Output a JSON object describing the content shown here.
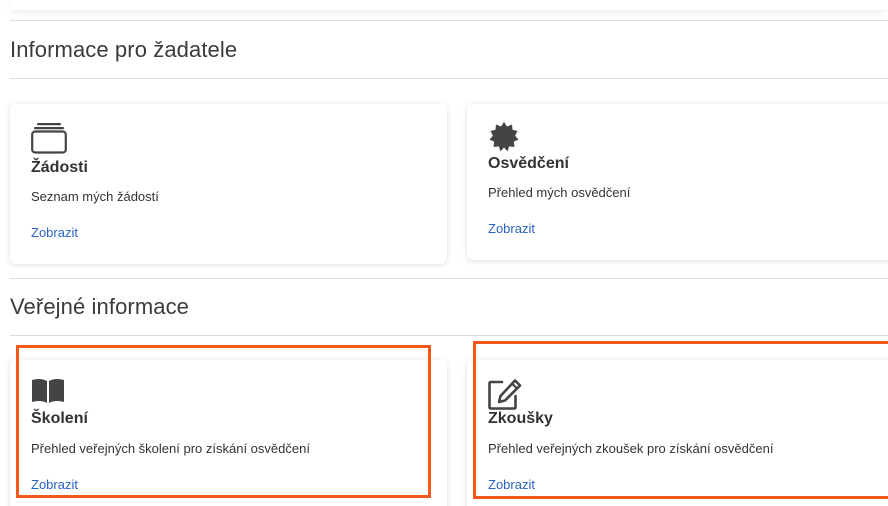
{
  "sections": {
    "applicant": {
      "title": "Informace pro žadatele",
      "cards": [
        {
          "title": "Žádosti",
          "description": "Seznam mých žádostí",
          "link": "Zobrazit",
          "icon": "tray-stack-icon"
        },
        {
          "title": "Osvědčení",
          "description": "Přehled mých osvědčení",
          "link": "Zobrazit",
          "icon": "certificate-badge-icon"
        }
      ]
    },
    "public": {
      "title": "Veřejné informace",
      "cards": [
        {
          "title": "Školení",
          "description": "Přehled veřejných školení pro získání osvědčení",
          "link": "Zobrazit",
          "icon": "open-book-icon"
        },
        {
          "title": "Zkoušky",
          "description": "Přehled veřejných zkoušek pro získání osvědčení",
          "link": "Zobrazit",
          "icon": "edit-pen-icon"
        }
      ]
    }
  },
  "colors": {
    "link": "#2a63c4",
    "highlight": "#f15a1a",
    "icon": "#444444"
  }
}
